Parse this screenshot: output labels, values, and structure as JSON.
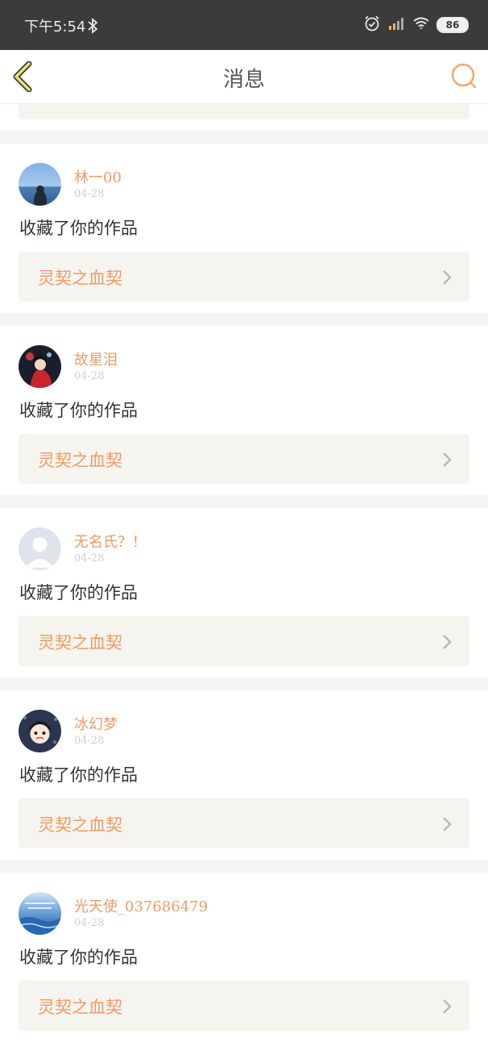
{
  "status_bar": {
    "time": "下午5:54",
    "battery": "86",
    "icons": [
      "bluetooth-icon",
      "alarm-icon",
      "signal-icon",
      "wifi-icon",
      "battery-icon"
    ]
  },
  "nav": {
    "title": "消息",
    "back_icon": "back-chevron-icon",
    "search_icon": "search-icon"
  },
  "colors": {
    "accent": "#ee9b66",
    "status_bar": "#3b3b3b",
    "card_bg": "#f5f4ee",
    "separator": "#f4f4f4"
  },
  "messages": [
    {
      "user": "林一00",
      "date": "04-28",
      "action": "收藏了你的作品",
      "work": "灵契之血契"
    },
    {
      "user": "故星泪",
      "date": "04-28",
      "action": "收藏了你的作品",
      "work": "灵契之血契"
    },
    {
      "user": "无名氏？！",
      "date": "04-28",
      "action": "收藏了你的作品",
      "work": "灵契之血契"
    },
    {
      "user": "冰幻梦",
      "date": "04-28",
      "action": "收藏了你的作品",
      "work": "灵契之血契"
    },
    {
      "user": "光天使_037686479",
      "date": "04-28",
      "action": "收藏了你的作品",
      "work": "灵契之血契"
    }
  ]
}
